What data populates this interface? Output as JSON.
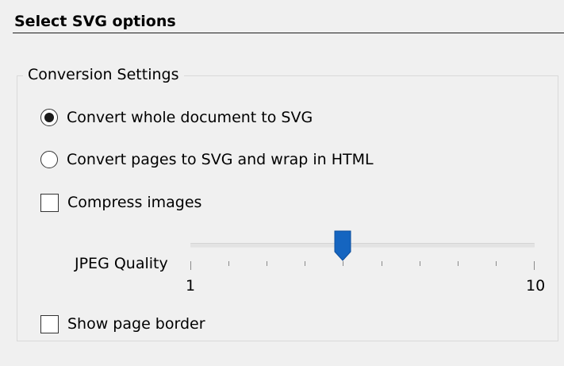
{
  "header": {
    "title": "Select SVG options"
  },
  "conversion_settings": {
    "legend": "Conversion Settings",
    "options": [
      {
        "label": "Convert whole document to SVG",
        "selected": true
      },
      {
        "label": "Convert pages to SVG and wrap in HTML",
        "selected": false
      }
    ],
    "compress_images": {
      "label": "Compress images",
      "checked": false
    },
    "jpeg_quality": {
      "label": "JPEG Quality",
      "min_label": "1",
      "max_label": "10",
      "min": 1,
      "max": 10,
      "value": 5
    },
    "show_page_border": {
      "label": "Show page border",
      "checked": false
    }
  },
  "colors": {
    "slider_thumb": "#1565c0",
    "background": "#f0f0f0"
  }
}
